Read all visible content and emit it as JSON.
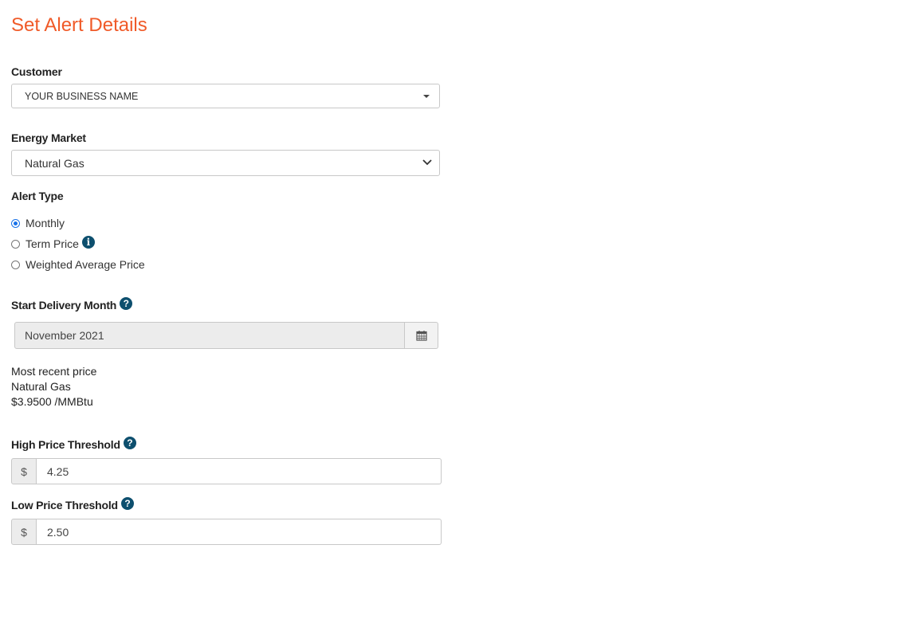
{
  "page": {
    "title": "Set Alert Details"
  },
  "customer": {
    "label": "Customer",
    "selected": "YOUR BUSINESS NAME"
  },
  "energy_market": {
    "label": "Energy Market",
    "selected": "Natural Gas"
  },
  "alert_type": {
    "label": "Alert Type",
    "options": [
      {
        "label": "Monthly",
        "checked": true
      },
      {
        "label": "Term Price",
        "checked": false,
        "icon": "info-icon"
      },
      {
        "label": "Weighted Average Price",
        "checked": false
      }
    ]
  },
  "start_delivery": {
    "label": "Start Delivery Month",
    "value": "November 2021",
    "icon": "help-icon",
    "button_icon": "calendar-icon"
  },
  "recent_price": {
    "line1": "Most recent price",
    "line2": "Natural Gas",
    "line3": "$3.9500 /MMBtu"
  },
  "high_threshold": {
    "label": "High Price Threshold",
    "currency": "$",
    "value": "4.25"
  },
  "low_threshold": {
    "label": "Low Price Threshold",
    "currency": "$",
    "value": "2.50"
  },
  "colors": {
    "accent": "#f05a28",
    "icon": "#0d4f6e",
    "radio": "#1a73e8"
  }
}
